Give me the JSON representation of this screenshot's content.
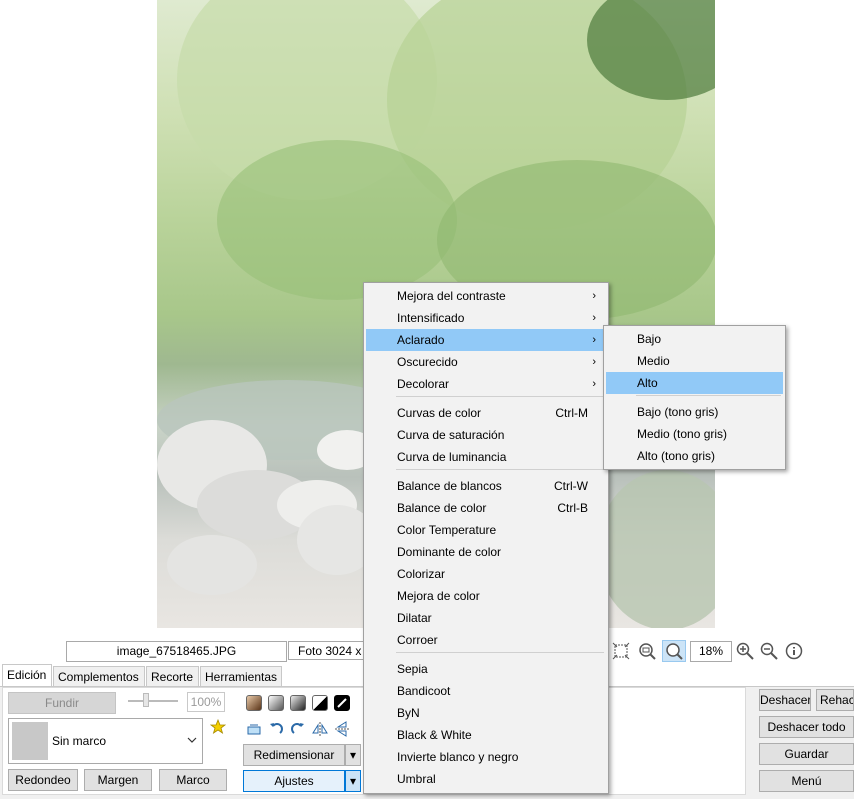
{
  "status": {
    "filename": "image_67518465.JPG",
    "photo_info": "Foto 3024 x",
    "zoom": "18%"
  },
  "tabs": [
    "Edición",
    "Complementos",
    "Recorte",
    "Herramientas"
  ],
  "edit": {
    "fundir": "Fundir",
    "percent": "100%",
    "frame_select": "Sin marco",
    "redondeo": "Redondeo",
    "margen": "Margen",
    "marco": "Marco",
    "redimensionar": "Redimensionar",
    "ajustes": "Ajustes"
  },
  "right_buttons": {
    "deshacer": "Deshacer",
    "rehacer": "Rehacer",
    "deshacer_todo": "Deshacer todo",
    "guardar": "Guardar",
    "menu": "Menú"
  },
  "main_menu": {
    "items": [
      {
        "label": "Mejora del contraste",
        "shortcut": "",
        "submenu": true
      },
      {
        "label": "Intensificado",
        "shortcut": "",
        "submenu": true
      },
      {
        "label": "Aclarado",
        "shortcut": "",
        "submenu": true
      },
      {
        "label": "Oscurecido",
        "shortcut": "",
        "submenu": true
      },
      {
        "label": "Decolorar",
        "shortcut": "",
        "submenu": true
      },
      {
        "label": "Curvas de color",
        "shortcut": "Ctrl-M",
        "submenu": false
      },
      {
        "label": "Curva de saturación",
        "shortcut": "",
        "submenu": false
      },
      {
        "label": "Curva de luminancia",
        "shortcut": "",
        "submenu": false
      },
      {
        "label": "Balance de blancos",
        "shortcut": "Ctrl-W",
        "submenu": false
      },
      {
        "label": "Balance de color",
        "shortcut": "Ctrl-B",
        "submenu": false
      },
      {
        "label": "Color Temperature",
        "shortcut": "",
        "submenu": false
      },
      {
        "label": "Dominante de color",
        "shortcut": "",
        "submenu": false
      },
      {
        "label": "Colorizar",
        "shortcut": "",
        "submenu": false
      },
      {
        "label": "Mejora de color",
        "shortcut": "",
        "submenu": false
      },
      {
        "label": "Dilatar",
        "shortcut": "",
        "submenu": false
      },
      {
        "label": "Corroer",
        "shortcut": "",
        "submenu": false
      },
      {
        "label": "Sepia",
        "shortcut": "",
        "submenu": false
      },
      {
        "label": "Bandicoot",
        "shortcut": "",
        "submenu": false
      },
      {
        "label": "ByN",
        "shortcut": "",
        "submenu": false
      },
      {
        "label": "Black & White",
        "shortcut": "",
        "submenu": false
      },
      {
        "label": "Invierte blanco y negro",
        "shortcut": "",
        "submenu": false
      },
      {
        "label": "Umbral",
        "shortcut": "",
        "submenu": false
      }
    ],
    "highlighted": "Aclarado"
  },
  "sub_menu": {
    "items": [
      "Bajo",
      "Medio",
      "Alto",
      "Bajo (tono gris)",
      "Medio (tono gris)",
      "Alto (tono gris)"
    ],
    "highlighted": "Alto"
  },
  "colors": {
    "highlight": "#91c9f7",
    "menu_bg": "#f2f2f2"
  },
  "icons": [
    "star-icon",
    "zoom-fit-icon",
    "zoom-actual-icon",
    "zoom-in-icon",
    "zoom-out-icon",
    "info-icon",
    "chevron-down-icon",
    "undo-icon",
    "redo-icon",
    "flip-icon",
    "rotate-icon"
  ]
}
